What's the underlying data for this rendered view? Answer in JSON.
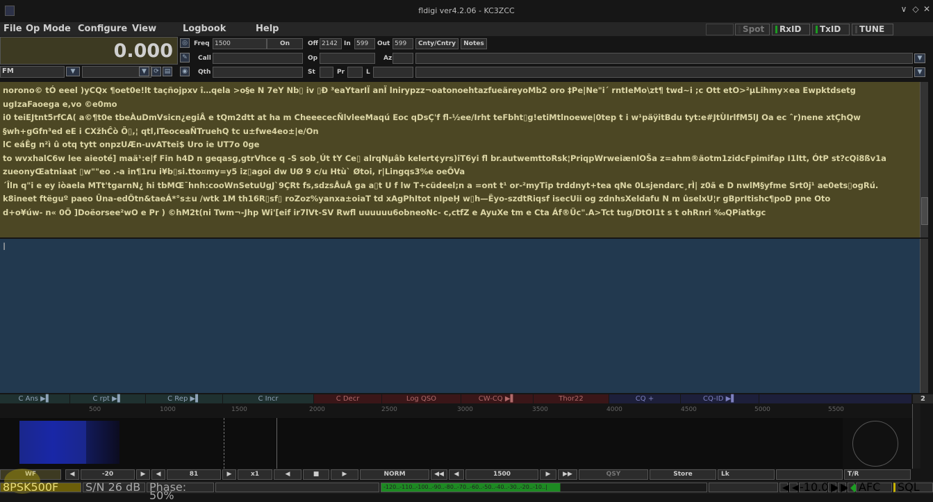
{
  "titlebar": {
    "title": "fldigi ver4.2.06 - KC3ZCC",
    "min": "∨",
    "max": "◇",
    "close": "✕"
  },
  "menu": {
    "file": "File",
    "opmode": "Op Mode",
    "configure": "Configure",
    "view": "View",
    "logbook": "Logbook",
    "help": "Help"
  },
  "top_right": {
    "spot": "Spot",
    "rxid": "RxID",
    "txid": "TxID",
    "tune": "TUNE"
  },
  "freq": {
    "display": "0.000",
    "mode": "FM"
  },
  "qso": {
    "freq_label": "Freq",
    "freq_value": "1500",
    "on_label": "On",
    "off_label": "Off",
    "off_value": "2142",
    "in_label": "In",
    "in_value": "599",
    "out_label": "Out",
    "out_value": "599",
    "cnty_label": "Cnty/Cntry",
    "notes_label": "Notes",
    "call_label": "Call",
    "op_label": "Op",
    "az_label": "Az",
    "qth_label": "Qth",
    "st_label": "St",
    "pr_label": "Pr",
    "l_label": "L"
  },
  "rx_text": [
    "norono© tÓ eeel )yCQx ¶oet0e!lt taçñojpxv î…qela >o§e N 7eY Nb▯ iv ▯Ð ³eaYtarIÏ anÏ lnirypzz¬oatonoehtazfueäreyoMb2 oro ‡Pe|Ne\"i´ rntIeMo\\zt¶ twd~i ;c Ott etO>²µLihmy×ea Ewpktdsetg",
    "ugIzaFaoega e,vo ©e0mo",
    "i0 teiEJtnt5rfCA( a©¶t0e tbeÀuDmVsicn¿egiÂ e tQm2dtt at ha m CheeececÑlvleeMaqú Eoc qDsÇ'f fl-½ee/Irht teFbht▯g!etiMtlnoewe|0tep t i w¹päÿitBdu tyt:e#JtÙIrlfM5lJ Oa ec ˆr)nene xtÇhQw",
    "§wh+gGfn³ed eE i CXžhĈò Õ▯,¦ qtl‚ITeoceaÑTruehQ tc u±fwe4eo±|e/On",
    "lC eáÊg n²ì û otq tytt onpzUÆn-uvATtei$ Uro ie UT7o 0ge",
    "to wvxhalC6w lee aieoté] maä¹:e|f Fin h4D n geqasg,gtrVhce q -S sob¸Út tY Ce▯ alrqNµâb kelert¢yrs)iT6yi fl br.autwemttoRsk¦PriqpWrweiænlOŠa z=ahm®äotm1zidcFpimifap I1ltt, ÓtP st?cQi8ßv1a",
    "zueonyŒatniaat ▯w\"\"eo .-a in¶1ru i¥b▯si.tto¤my=y5 iz▯agoi dw UØ 9 c/u Htù` Øtoi, r|Lingqs3%e oeÕVa",
    "´Îln q\"i e ey iòaela MTt'tgarnN¿ hi tbMŒ¯hnh:cooWnSetuUgJ`9ÇRt fs,sdzsÅuÅ ga a▯t U f lw T+cüdeel;n a =ont t¹ or-²myTip trddnyt+tea qNe 0Lsjendarc¸rÌ| z0ã e D nwlM§yfme Srt0j¹ ae0ets▯ogRú.",
    "k8ineet ftëguº paeo Ûna-edÖtn&taeÁ*°s±u /wtk 1M th16R▯sf▯ roZoz%yanxa±oiaT td xAgPhItot nIpeH͏̗ ͏w▯h—Ëyo-szdtRiqsf isecUii og zdnhsXeldafu N m ûselxU¦r gBprItishc¶poD pne Oto",
    "d+o¥úw- n« 0Ö ]Doëorsee²wO e Pr ) ©hM2t(ni Twm¬-Jhp Wi'[eif ir7lVt-SV Rwfl uuuuuu6obneoNc- c,ctfZ e AyuXe tm e Cta Áf®Üc\".A>Tct tug/DtOI1t s t ohRnri ‰QPiatkgc"
  ],
  "tx_cursor": "I",
  "macros": [
    "C Ans ▶▌",
    "C rpt ▶▌",
    "C Rep ▶▌",
    "C Incr",
    "C Decr",
    "Log QSO",
    "CW-CQ ▶▌",
    "Thor22",
    "CQ +",
    "CQ-ID ▶▌"
  ],
  "macro_bank": "2",
  "wf_scale": [
    "500",
    "1000",
    "1500",
    "2000",
    "2500",
    "3000",
    "3500",
    "4000",
    "4500",
    "5000",
    "5500"
  ],
  "wf_controls": {
    "wf": "WF",
    "level": "-20",
    "range": "81",
    "zoom": "x1",
    "norm": "NORM",
    "freq": "1500",
    "qsy": "QSY",
    "store": "Store",
    "lk": "Lk",
    "tr": "T/R"
  },
  "status": {
    "mode": "8PSK500F",
    "sn": "S/N 26 dB",
    "phase": "Phase: 50%",
    "meter": "-120..-110..-100..-90..-80..-70..-60..-50..-40..-30..-20..-10..|",
    "squelch": "-10.0",
    "afc": "AFC",
    "sql": "SQL"
  },
  "colors": {
    "rx_bg": "#4c4724",
    "tx_bg": "#22394f",
    "led_green": "#1c9c22",
    "tune_red": "#c0202a",
    "status_yellow": "#c8b400"
  }
}
